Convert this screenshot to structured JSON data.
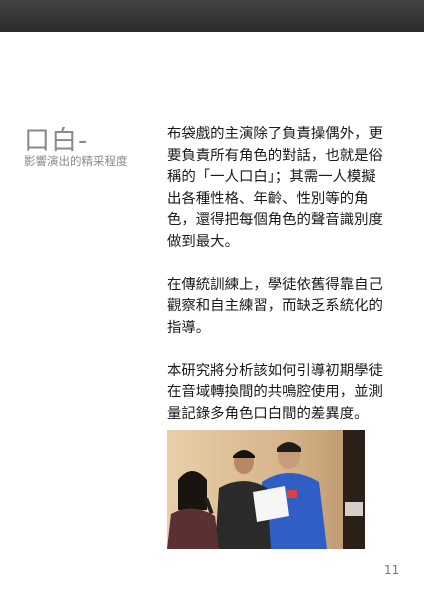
{
  "section": {
    "title": "口白-",
    "subtitle": "影響演出的精采程度"
  },
  "paragraphs": [
    "布袋戲的主演除了負責操偶外，更要負責所有角色的對話，也就是俗稱的「一人口白」；其需一人模擬出各種性格、年齡、性別等的角色，還得把每個角色的聲音識別度做到最大。",
    "在傳統訓練上，學徒依舊得靠自己觀察和自主練習，而缺乏系統化的指導。",
    "本研究將分析該如何引導初期學徒在音域轉換間的共鳴腔使用，並測量記錄多角色口白間的差異度。"
  ],
  "page_number": "11"
}
